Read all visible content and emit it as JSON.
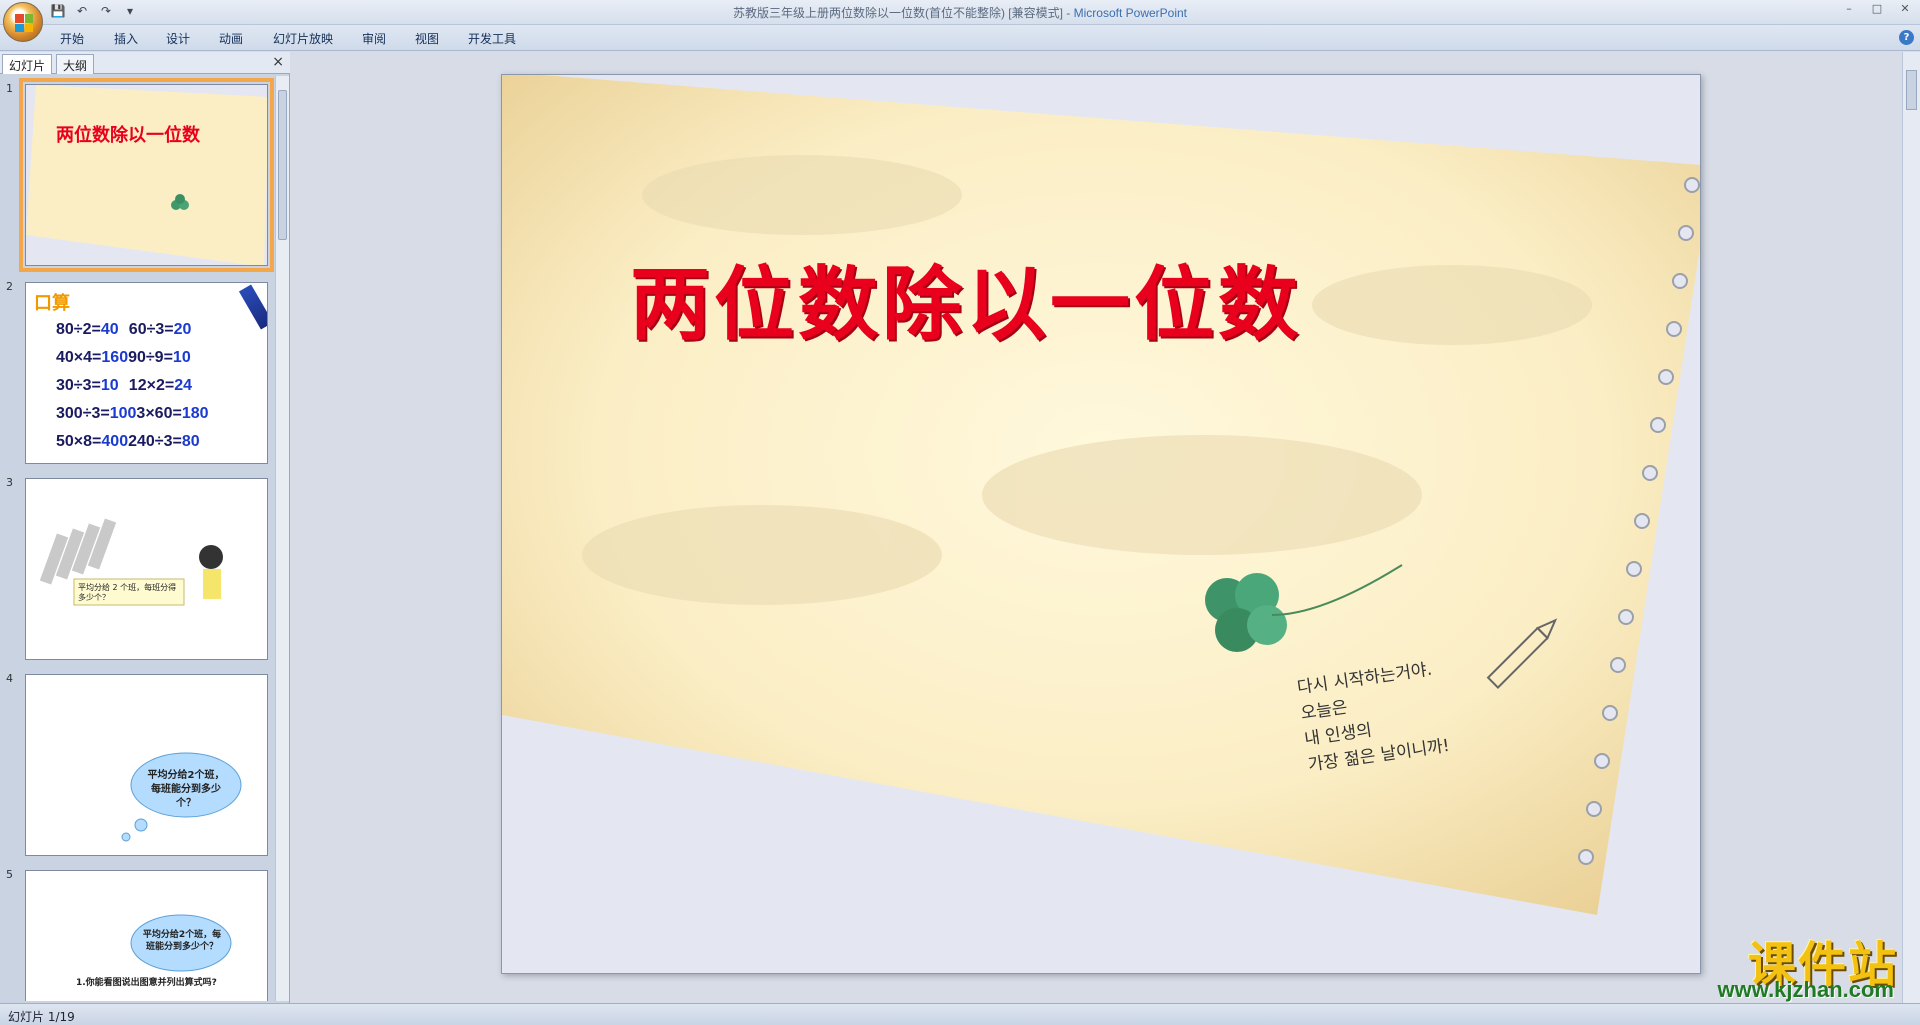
{
  "window": {
    "title": "苏教版三年级上册两位数除以一位数(首位不能整除) [兼容模式] - ",
    "app_name": "Microsoft PowerPoint"
  },
  "ribbon": {
    "tabs": [
      "开始",
      "插入",
      "设计",
      "动画",
      "幻灯片放映",
      "审阅",
      "视图",
      "开发工具"
    ]
  },
  "left_pane": {
    "tabs": [
      "幻灯片",
      "大纲"
    ],
    "close_label": "×",
    "slides": [
      {
        "num": "1",
        "title": "两位数除以一位数"
      },
      {
        "num": "2",
        "title": "口算",
        "rows": [
          [
            "80÷2=",
            "40",
            "60÷3=",
            "20"
          ],
          [
            "40×4=",
            "160",
            "90÷9=",
            "10"
          ],
          [
            "30÷3=",
            "10",
            "12×2=",
            "24"
          ],
          [
            "300÷3=",
            "100",
            "3×60=",
            "180"
          ],
          [
            "50×8=",
            "400",
            "240÷3=",
            "80"
          ]
        ]
      },
      {
        "num": "3",
        "caption": "平均分给 2 个班，每班分得多少个？"
      },
      {
        "num": "4",
        "caption": "平均分给2个班，每班能分到多少个？"
      },
      {
        "num": "5",
        "caption": "平均分给2个班，每班能分到多少个？",
        "question": "1.你能看图说出图意并列出算式吗?"
      }
    ]
  },
  "slide": {
    "title": "两位数除以一位数",
    "handwriting": [
      "다시 시작하는거야.",
      "오늘은",
      "내 인생의",
      "가장 젊은 날이니까!"
    ]
  },
  "status": {
    "slide_counter": "幻灯片 1/19"
  },
  "watermark": {
    "cn": "课件站",
    "url": "www.kjzhan.com"
  },
  "colors": {
    "title_red": "#e8001c",
    "paper": "#fbeec5",
    "selection": "#f3a64a",
    "ribbon": "#d6dfec"
  }
}
